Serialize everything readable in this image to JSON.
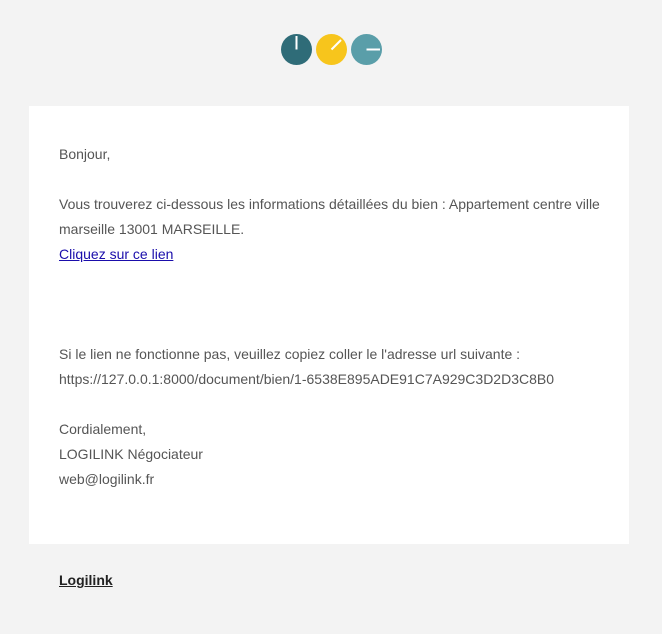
{
  "header": {
    "logo_icons": [
      "teal-clock-icon",
      "yellow-clock-icon",
      "blue-clock-icon"
    ],
    "colors": {
      "teal": "#2f6c78",
      "yellow": "#f7c51c",
      "blue": "#5a9ea9"
    }
  },
  "email": {
    "greeting": "Bonjour,",
    "intro_line1": "Vous trouverez ci-dessous les informations détaillées du bien : Appartement centre ville",
    "intro_line2": "marseille 13001 MARSEILLE.",
    "link_text": "Cliquez sur ce lien",
    "fallback_text": "Si le lien ne fonctionne pas, veuillez copiez coller le l'adresse url suivante :",
    "fallback_url": "https://127.0.0.1:8000/document/bien/1-6538E895ADE91C7A929C3D2D3C8B0",
    "closing": "Cordialement,",
    "signature_name": "LOGILINK Négociateur",
    "signature_email": "web@logilink.fr"
  },
  "footer": {
    "brand_link": "Logilink"
  }
}
